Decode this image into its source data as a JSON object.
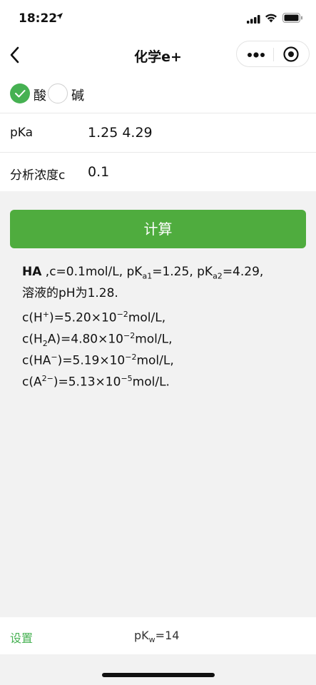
{
  "status": {
    "time": "18:22",
    "location_icon": "location-arrow-icon"
  },
  "nav": {
    "title": "化学e+"
  },
  "options": {
    "acid": "酸",
    "base": "碱",
    "selected": "acid"
  },
  "form": {
    "pka_label": "pKa",
    "pka_value": "1.25 4.29",
    "conc_label": "分析浓度c",
    "conc_value": "0.1"
  },
  "button": {
    "calculate": "计算"
  },
  "result": {
    "species": "HA",
    "line1_a": " ,c=0.1mol/L, pK",
    "line1_sub1": "a1",
    "line1_b": "=1.25, pK",
    "line1_sub2": "a2",
    "line1_c": "=4.29,",
    "line2": "溶液的pH为1.28.",
    "h_pre": "c(H",
    "h_sup": "+",
    "h_mid": ")=5.20×10",
    "h_exp": "−2",
    "h_unit": "mol/L,",
    "h2a_pre": "c(H",
    "h2a_sub": "2",
    "h2a_mid": "A)=4.80×10",
    "h2a_exp": "−2",
    "h2a_unit": "mol/L,",
    "ha_pre": "c(HA",
    "ha_sup": "−",
    "ha_mid": ")=5.19×10",
    "ha_exp": "−2",
    "ha_unit": "mol/L,",
    "a_pre": "c(A",
    "a_sup": "2−",
    "a_mid": ")=5.13×10",
    "a_exp": "−5",
    "a_unit": "mol/L."
  },
  "bottom": {
    "settings": "设置",
    "pkw_pre": "pK",
    "pkw_sub": "w",
    "pkw_post": "=14"
  }
}
